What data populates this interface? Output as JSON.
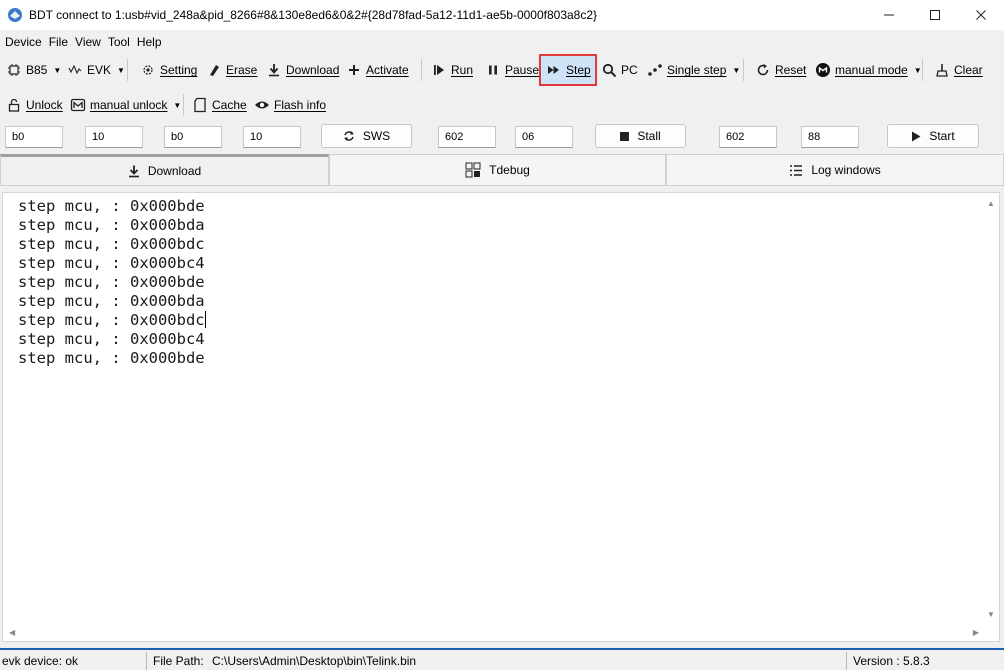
{
  "window": {
    "title": "BDT connect to 1:usb#vid_248a&pid_8266#8&130e8ed6&0&2#{28d78fad-5a12-11d1-ae5b-0000f803a8c2}",
    "minimize_glyph": "—",
    "maximize_glyph": "☐",
    "close_glyph": "✕"
  },
  "menu": {
    "items": [
      "Device",
      "File",
      "View",
      "Tool",
      "Help"
    ]
  },
  "toolbar1": {
    "chip": "B85",
    "board": "EVK",
    "setting": "Setting",
    "erase": "Erase",
    "download": "Download",
    "activate": "Activate",
    "run": "Run",
    "pause": "Pause",
    "step": "Step",
    "pc": "PC",
    "single_step": "Single step",
    "reset": "Reset",
    "manual_mode": "manual mode",
    "clear": "Clear"
  },
  "toolbar2": {
    "unlock": "Unlock",
    "manual_unlock": "manual unlock",
    "cache": "Cache",
    "flash_info": "Flash info"
  },
  "inputs": {
    "f1": "b0",
    "f2": "10",
    "f3": "b0",
    "f4": "10",
    "sws": "SWS",
    "f5": "602",
    "f6": "06",
    "stall": "Stall",
    "f7": "602",
    "f8": "88",
    "start": "Start"
  },
  "tabs": [
    "Download",
    "Tdebug",
    "Log windows"
  ],
  "log": {
    "lines": [
      "step mcu, : 0x000bde",
      "step mcu, : 0x000bda",
      "step mcu, : 0x000bdc",
      "step mcu, : 0x000bc4",
      "step mcu, : 0x000bde",
      "step mcu, : 0x000bda",
      "step mcu, : 0x000bdc",
      "step mcu, : 0x000bc4",
      "step mcu, : 0x000bde"
    ]
  },
  "status": {
    "device": "evk device: ok",
    "file_path_label": "File Path:",
    "file_path": "C:\\Users\\Admin\\Desktop\\bin\\Telink.bin",
    "version": "Version : 5.8.3"
  },
  "colors": {
    "highlight_border": "#e03a3a",
    "highlight_fill": "#cfe3f7",
    "status_accent": "#1f5fb0"
  }
}
